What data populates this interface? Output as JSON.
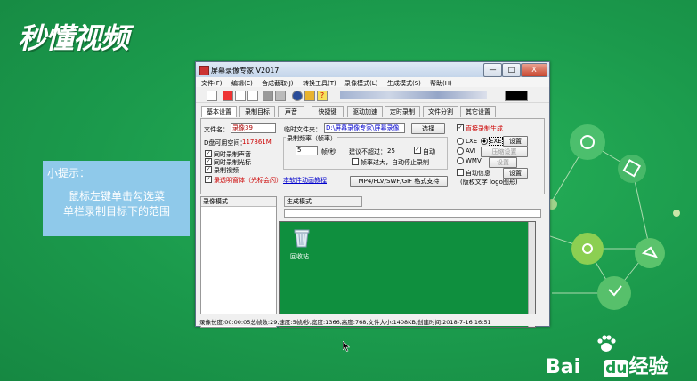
{
  "brand": {
    "logo_text": "秒懂视频",
    "footer_logo": "Bai",
    "footer_logo_2": "du",
    "footer_logo_3": "经验"
  },
  "tip": {
    "title": "小提示：",
    "line1": "鼠标左键单击勾选菜",
    "line2": "单栏录制目标下的范围"
  },
  "window": {
    "title": "屏幕录像专家 V2017",
    "controls": {
      "minimize": "—",
      "maximize": "□",
      "close": "X"
    },
    "menu": [
      "文件(F)",
      "编辑(E)",
      "合成截取(J)",
      "转换工具(T)",
      "录像模式(L)",
      "生成模式(S)",
      "帮助(H)"
    ],
    "tabs": [
      "基本设置",
      "录制目标",
      "声音",
      "快捷键",
      "驱动加速",
      "定时录制",
      "文件分割",
      "其它设置"
    ],
    "basic": {
      "filename_label": "文件名：",
      "filename_value": "录像39",
      "temp_folder_label": "临时文件夹：",
      "temp_folder_value": "D:\\屏幕录像专家\\屏幕录像",
      "select_button": "选择",
      "disk_space_label": "D盘可用空间：",
      "disk_space_value": "117861M",
      "record_sound": "同时录制声音",
      "record_cursor": "同时录制光标",
      "record_video": "录制视频",
      "record_transparent": "录透明窗体（光标会闪）",
      "tutorial_link": "本软件动画教程",
      "frame_rate_group": "录制频率（帧率）",
      "fps_value": "5",
      "fps_unit": "帧/秒",
      "fps_hint_label": "建议不超过：",
      "fps_hint_value": "25",
      "auto_label": "自动",
      "stop_on_fast": "帧率过大，自动停止录制",
      "format_button": "MP4/FLV/SWF/GIF 格式支持",
      "direct_generate": "直接录制生成",
      "lxe_label": "LXE",
      "exe_label": "EXE",
      "avi_label": "AVI",
      "wmv_label": "WMV",
      "settings_button": "设置",
      "compress_button": "压缩设置",
      "settings_button_2": "设置",
      "auto_info": "自动信息",
      "settings_button_3": "设置",
      "copyright_note": "(版权文字 logo图形)"
    },
    "record_list_header": "录像模式",
    "generate_header": "生成模式",
    "desktop_icon_label": "回收站",
    "status_text": "录像长度:00:00:05总帧数:29,速度:5帧/秒,宽度:1366,高度:768,文件大小:1408KB,创建时间:2018-7-16 16:51"
  },
  "colors": {
    "background": "#1b9a4c",
    "tip_box": "#8fc9ea",
    "desktop": "#0f8f3e",
    "link": "#0000cc",
    "warning_text": "#cc0000"
  }
}
